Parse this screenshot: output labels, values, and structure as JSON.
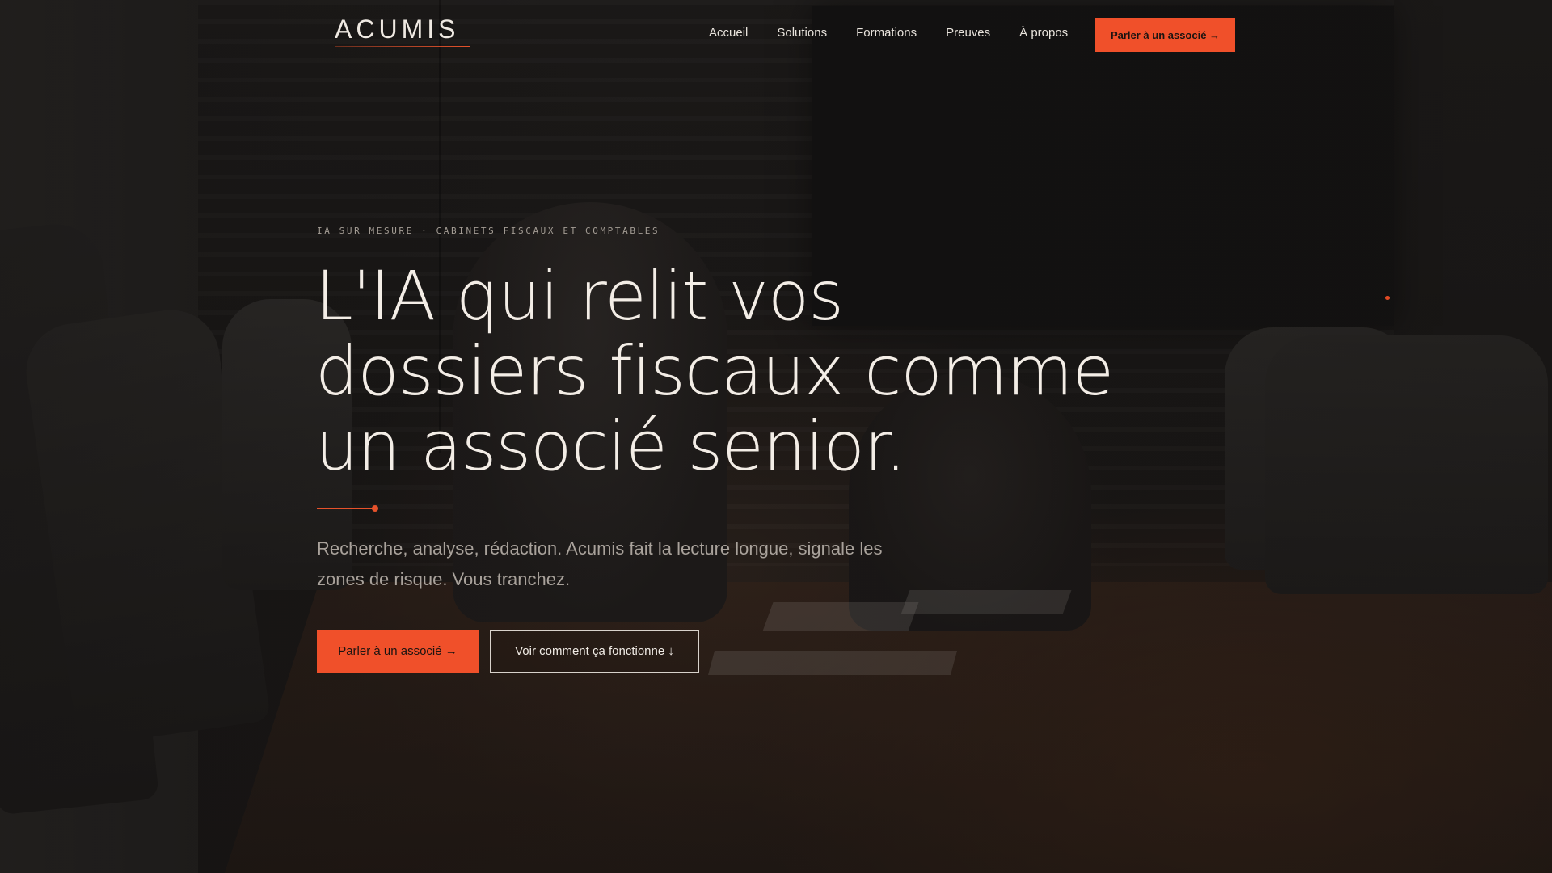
{
  "brand": {
    "logo": "ACUMIS",
    "accent": "#f0502a"
  },
  "nav": {
    "items": [
      {
        "label": "Accueil",
        "active": true
      },
      {
        "label": "Solutions",
        "active": false
      },
      {
        "label": "Formations",
        "active": false
      },
      {
        "label": "Preuves",
        "active": false
      },
      {
        "label": "À propos",
        "active": false
      }
    ],
    "cta": "Parler à un associé →"
  },
  "hero": {
    "eyebrow": "IA SUR MESURE · CABINETS FISCAUX ET COMPTABLES",
    "headline_lines": [
      "L'IA qui relit vos",
      "dossiers fiscaux comme",
      "un associé senior."
    ],
    "subtitle": "Recherche, analyse, rédaction. Acumis fait la lecture longue, signale les zones de risque. Vous tranchez.",
    "primary_button": "Parler à un associé →",
    "secondary_button": "Voir comment ça fonctionne ↓"
  }
}
